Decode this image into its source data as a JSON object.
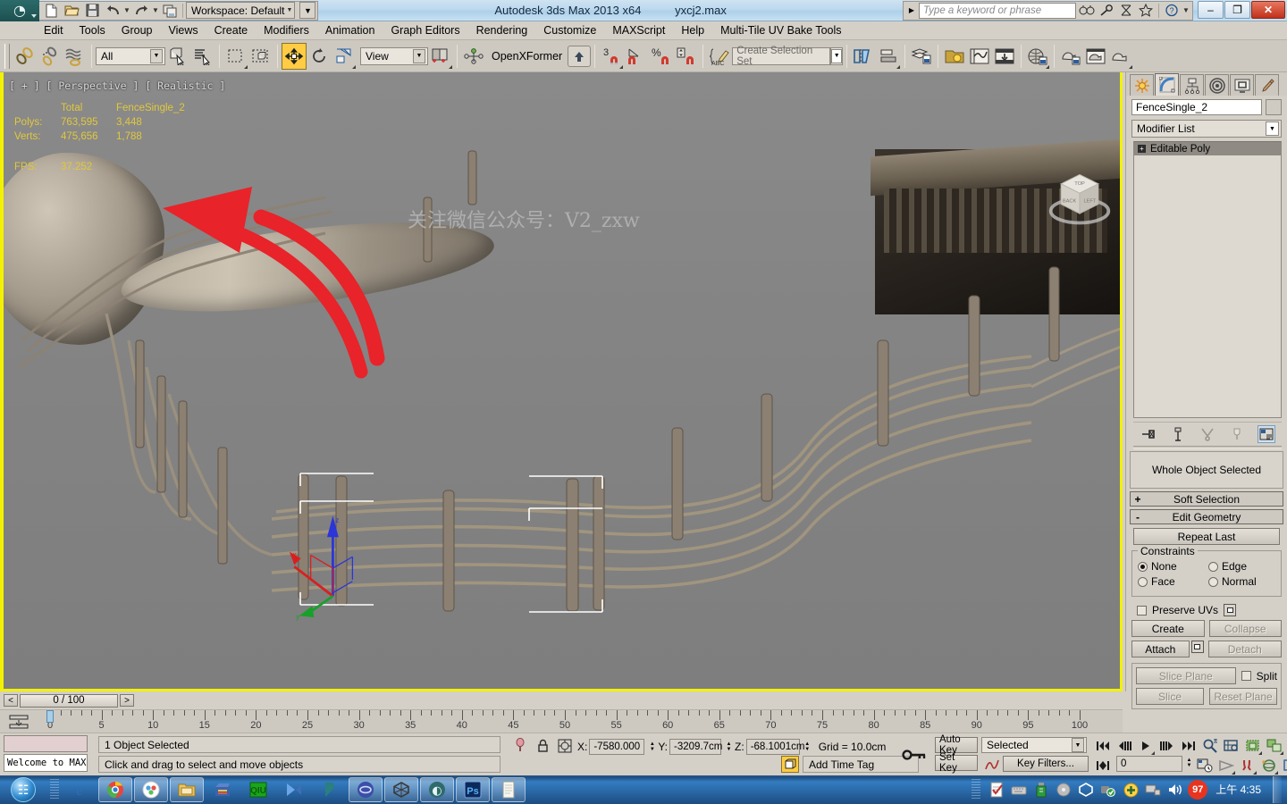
{
  "titlebar": {
    "app_title": "Autodesk 3ds Max  2013 x64",
    "file_name": "yxcj2.max",
    "workspace_label": "Workspace: Default",
    "quick_access": [
      {
        "name": "new-file-icon",
        "label": "New"
      },
      {
        "name": "open-file-icon",
        "label": "Open"
      },
      {
        "name": "save-file-icon",
        "label": "Save"
      },
      {
        "name": "undo-icon",
        "label": "Undo"
      },
      {
        "name": "redo-icon",
        "label": "Redo"
      },
      {
        "name": "project-folder-icon",
        "label": "Set Project Folder"
      }
    ],
    "infocenter_placeholder": "Type a keyword or phrase",
    "infocenter_buttons": [
      "search-icon",
      "subscription-icon",
      "communication-center-icon",
      "favorites-icon",
      "help-icon"
    ],
    "window_buttons": {
      "minimize": "–",
      "restore": "❐",
      "close": "✕"
    }
  },
  "menubar": {
    "items": [
      {
        "label": "Edit"
      },
      {
        "label": "Tools"
      },
      {
        "label": "Group"
      },
      {
        "label": "Views"
      },
      {
        "label": "Create"
      },
      {
        "label": "Modifiers"
      },
      {
        "label": "Animation"
      },
      {
        "label": "Graph Editors"
      },
      {
        "label": "Rendering"
      },
      {
        "label": "Customize"
      },
      {
        "label": "MAXScript"
      },
      {
        "label": "Help"
      },
      {
        "label": "Multi-Tile UV Bake Tools"
      }
    ]
  },
  "toolbar": {
    "selection_filter": "All",
    "reference_coord_system": "View",
    "named_selection_set_placeholder": "Create Selection Set",
    "openxformer_label": "OpenXFormer",
    "snap_percent_label": "%",
    "snap_3_label": "3",
    "buttons": [
      {
        "name": "select-and-link-icon"
      },
      {
        "name": "unlink-selection-icon"
      },
      {
        "name": "bind-to-space-warp-icon"
      },
      {
        "name": "select-object-icon"
      },
      {
        "name": "select-by-name-icon"
      },
      {
        "name": "rectangular-selection-region-icon"
      },
      {
        "name": "window-crossing-toggle-icon"
      },
      {
        "name": "select-and-move-icon"
      },
      {
        "name": "select-and-rotate-icon"
      },
      {
        "name": "select-and-uniform-scale-icon"
      },
      {
        "name": "use-center-flyout-icon"
      },
      {
        "name": "use-selection-center-icon"
      },
      {
        "name": "openxformer-up-icon"
      },
      {
        "name": "snaps-toggle-icon"
      },
      {
        "name": "angle-snap-toggle-icon"
      },
      {
        "name": "percent-snap-toggle-icon"
      },
      {
        "name": "spinner-snap-toggle-icon"
      },
      {
        "name": "edit-named-selection-sets-icon"
      },
      {
        "name": "mirror-icon"
      },
      {
        "name": "align-icon"
      },
      {
        "name": "layer-manager-icon"
      },
      {
        "name": "light-lister-icon"
      },
      {
        "name": "curve-editor-icon"
      },
      {
        "name": "schematic-view-icon"
      },
      {
        "name": "material-editor-icon"
      },
      {
        "name": "render-setup-icon"
      },
      {
        "name": "rendered-frame-window-icon"
      },
      {
        "name": "render-production-icon"
      }
    ]
  },
  "viewport": {
    "label": "[ + ] [ Perspective ] [ Realistic ]",
    "watermark": "关注微信公众号：V2_zxw",
    "stats": {
      "col_total": "Total",
      "col_object": "FenceSingle_2",
      "polys_label": "Polys:",
      "polys_total": "763,595",
      "polys_object": "3,448",
      "verts_label": "Verts:",
      "verts_total": "475,656",
      "verts_object": "1,788",
      "fps_label": "FPS:",
      "fps_value": "37.252"
    },
    "viewcube_faces": {
      "top": "TOP",
      "front": "BACK",
      "right": "LEFT"
    },
    "axis_tripod": {
      "x": "x",
      "y": "y",
      "z": "z"
    },
    "gizmo_axes": {
      "x": "x",
      "y": "y",
      "z": "z"
    },
    "annotation_color": "#e8232a"
  },
  "command_panel": {
    "tabs": [
      {
        "name": "create-tab",
        "label": "Create"
      },
      {
        "name": "modify-tab",
        "label": "Modify"
      },
      {
        "name": "hierarchy-tab",
        "label": "Hierarchy"
      },
      {
        "name": "motion-tab",
        "label": "Motion"
      },
      {
        "name": "display-tab",
        "label": "Display"
      },
      {
        "name": "utilities-tab",
        "label": "Utilities"
      }
    ],
    "selected_tab_index": 1,
    "object_name": "FenceSingle_2",
    "modifier_list_label": "Modifier List",
    "modifier_stack": [
      {
        "label": "Editable Poly",
        "expander": "+"
      }
    ],
    "stack_icons": [
      {
        "name": "pin-stack-icon"
      },
      {
        "name": "show-end-result-icon"
      },
      {
        "name": "make-unique-icon"
      },
      {
        "name": "remove-modifier-icon"
      },
      {
        "name": "configure-modifier-sets-icon"
      }
    ],
    "selection_status": "Whole Object Selected",
    "rollouts": [
      {
        "name": "soft-selection-rollout",
        "sign": "+",
        "label": "Soft Selection"
      },
      {
        "name": "edit-geometry-rollout",
        "sign": "-",
        "label": "Edit Geometry"
      }
    ],
    "edit_geometry": {
      "repeat_last": "Repeat Last",
      "constraints_title": "Constraints",
      "constraints": [
        {
          "label": "None",
          "selected": true
        },
        {
          "label": "Edge",
          "selected": false
        },
        {
          "label": "Face",
          "selected": false
        },
        {
          "label": "Normal",
          "selected": false
        }
      ],
      "preserve_uvs": "Preserve UVs",
      "create": "Create",
      "collapse": "Collapse",
      "attach": "Attach",
      "detach": "Detach",
      "slice_plane": "Slice Plane",
      "split": "Split",
      "slice": "Slice",
      "reset_plane": "Reset Plane"
    }
  },
  "timeline": {
    "frame_readout": "0 / 100",
    "prev_label": "<",
    "next_label": ">",
    "ticks": [
      "0",
      "5",
      "10",
      "15",
      "20",
      "25",
      "30",
      "35",
      "40",
      "45",
      "50",
      "55",
      "60",
      "65",
      "70",
      "75",
      "80",
      "85",
      "90",
      "95",
      "100"
    ],
    "current_frame": 0
  },
  "statusbar": {
    "maxscript_listener": "Welcome to MAXS",
    "selection_count": "1 Object Selected",
    "prompt": "Click and drag to select and move objects",
    "coord_x_label": "X:",
    "coord_x": "-7580.000",
    "coord_y_label": "Y:",
    "coord_y": "-3209.7cm",
    "coord_z_label": "Z:",
    "coord_z": "-68.1001cm",
    "grid": "Grid = 10.0cm",
    "add_time_tag": "Add Time Tag",
    "auto_key": "Auto Key",
    "set_key": "Set Key",
    "key_mode": "Selected",
    "key_filters": "Key Filters...",
    "key_frame_value": "0",
    "icons": [
      {
        "name": "isolate-selection-icon"
      },
      {
        "name": "selection-lock-toggle-icon"
      },
      {
        "name": "absolute-relative-transform-icon"
      },
      {
        "name": "key-mode-toggle-icon"
      }
    ],
    "nav_buttons": [
      {
        "name": "go-to-start-icon"
      },
      {
        "name": "previous-frame-icon"
      },
      {
        "name": "play-animation-icon"
      },
      {
        "name": "next-frame-icon"
      },
      {
        "name": "go-to-end-icon"
      },
      {
        "name": "zoom-icon"
      },
      {
        "name": "zoom-all-icon"
      },
      {
        "name": "zoom-extents-icon"
      },
      {
        "name": "zoom-extents-all-icon"
      },
      {
        "name": "field-of-view-icon"
      },
      {
        "name": "pan-view-icon"
      },
      {
        "name": "orbit-icon"
      },
      {
        "name": "maximize-viewport-toggle-icon"
      }
    ]
  },
  "taskbar": {
    "start_label": "Start",
    "items": [
      {
        "name": "internet-explorer-icon",
        "boxed": false
      },
      {
        "name": "google-chrome-icon",
        "boxed": true
      },
      {
        "name": "browser-icon",
        "boxed": true
      },
      {
        "name": "file-explorer-icon",
        "boxed": true
      },
      {
        "name": "winrar-icon",
        "boxed": false
      },
      {
        "name": "qq-icon",
        "boxed": false
      },
      {
        "name": "app-blue-icon",
        "boxed": false
      },
      {
        "name": "app-teal-icon",
        "boxed": false
      },
      {
        "name": "app-circle-icon",
        "boxed": true
      },
      {
        "name": "unity-icon",
        "boxed": true
      },
      {
        "name": "3dsmax-icon",
        "boxed": true
      },
      {
        "name": "photoshop-icon",
        "boxed": true
      },
      {
        "name": "notepad-icon",
        "boxed": true
      }
    ],
    "tray": [
      {
        "name": "tray-note-icon"
      },
      {
        "name": "tray-keyboard-icon"
      },
      {
        "name": "tray-usb-icon"
      },
      {
        "name": "tray-disc-icon"
      },
      {
        "name": "tray-unity-icon"
      },
      {
        "name": "tray-plug-icon"
      },
      {
        "name": "tray-update-icon"
      },
      {
        "name": "tray-network-icon"
      },
      {
        "name": "tray-volume-icon"
      }
    ],
    "notification_count": "97",
    "clock": "上午 4:35"
  }
}
